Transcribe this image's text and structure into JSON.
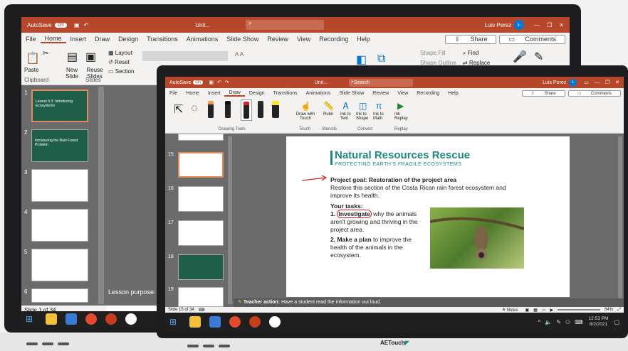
{
  "back": {
    "autosave": "AutoSave",
    "toggle": "Off",
    "doc_title": "Unit...",
    "user": "Luis Perez",
    "avatar": "L",
    "tabs": [
      "File",
      "Home",
      "Insert",
      "Draw",
      "Design",
      "Transitions",
      "Animations",
      "Slide Show",
      "Review",
      "View",
      "Recording",
      "Help"
    ],
    "share": "Share",
    "comments": "Comments",
    "ribbon": {
      "paste": "Paste",
      "new_slide": "New Slide",
      "reuse_slides": "Reuse Slides",
      "layout": "Layout",
      "reset": "Reset",
      "section": "Section",
      "clipboard": "Clipboard",
      "slides": "Slides",
      "shape_fill": "Shape Fill",
      "shape_outline": "Shape Outline",
      "find": "Find",
      "replace": "Replace"
    },
    "thumb_numbers": [
      "1",
      "2",
      "3",
      "4",
      "5",
      "6"
    ],
    "slide1_lines": [
      "Lesson 5.3: Introducing Ecosystems"
    ],
    "slide2_lines": [
      "Introducing the Rain Forest Problem"
    ],
    "notes_lesson": "Lesson purpose:",
    "status": "Slide 1 of 34"
  },
  "front": {
    "autosave": "AutoSave",
    "toggle": "On",
    "doc_title": "Unit...",
    "search": "Search",
    "user": "Luis Perez",
    "avatar": "L",
    "tabs": [
      "File",
      "Home",
      "Insert",
      "Draw",
      "Design",
      "Transitions",
      "Animations",
      "Slide Show",
      "Review",
      "View",
      "Recording",
      "Help"
    ],
    "share": "Share",
    "comments": "Comments",
    "ribbon": {
      "draw_with_touch": "Draw with Touch",
      "ruler": "Ruler",
      "ink_to_text": "Ink to Text",
      "ink_to_shape": "Ink to Shape",
      "ink_to_math": "Ink to Math",
      "ink_replay": "Ink Replay",
      "drawing_tools": "Drawing Tools",
      "touch": "Touch",
      "stencils": "Stencils",
      "convert": "Convert",
      "replay": "Replay"
    },
    "thumb_numbers": [
      "15",
      "16",
      "17",
      "18",
      "19"
    ],
    "slide": {
      "title": "Natural Resources Rescue",
      "subtitle": "PROTECTING EARTH'S FRAGILE ECOSYSTEMS",
      "goal_label": "Project goal: Restoration of the project area",
      "goal_text": "Restore this section of the Costa Rican rain forest ecosystem and improve its health.",
      "tasks_label": "Your tasks:",
      "task1_num": "1.",
      "task1_bold": "Investigate",
      "task1_text": " why the animals aren't growing and thriving in the project area.",
      "task2_num": "2.",
      "task2_bold": "Make a plan",
      "task2_text": " to improve the health of the animals in the ecosystem."
    },
    "notes": "Teacher action:",
    "notes_line2": "Have a student read the information out loud.",
    "status": "Slide 15 of 34",
    "notes_btn": "Notes",
    "zoom": "84%",
    "time": "12:53 PM",
    "date": "8/2/2021"
  },
  "brand": "AETouch",
  "colors": {
    "ppt_red": "#b7472a",
    "teal": "#1a8a83",
    "accent": "#0078d4"
  }
}
